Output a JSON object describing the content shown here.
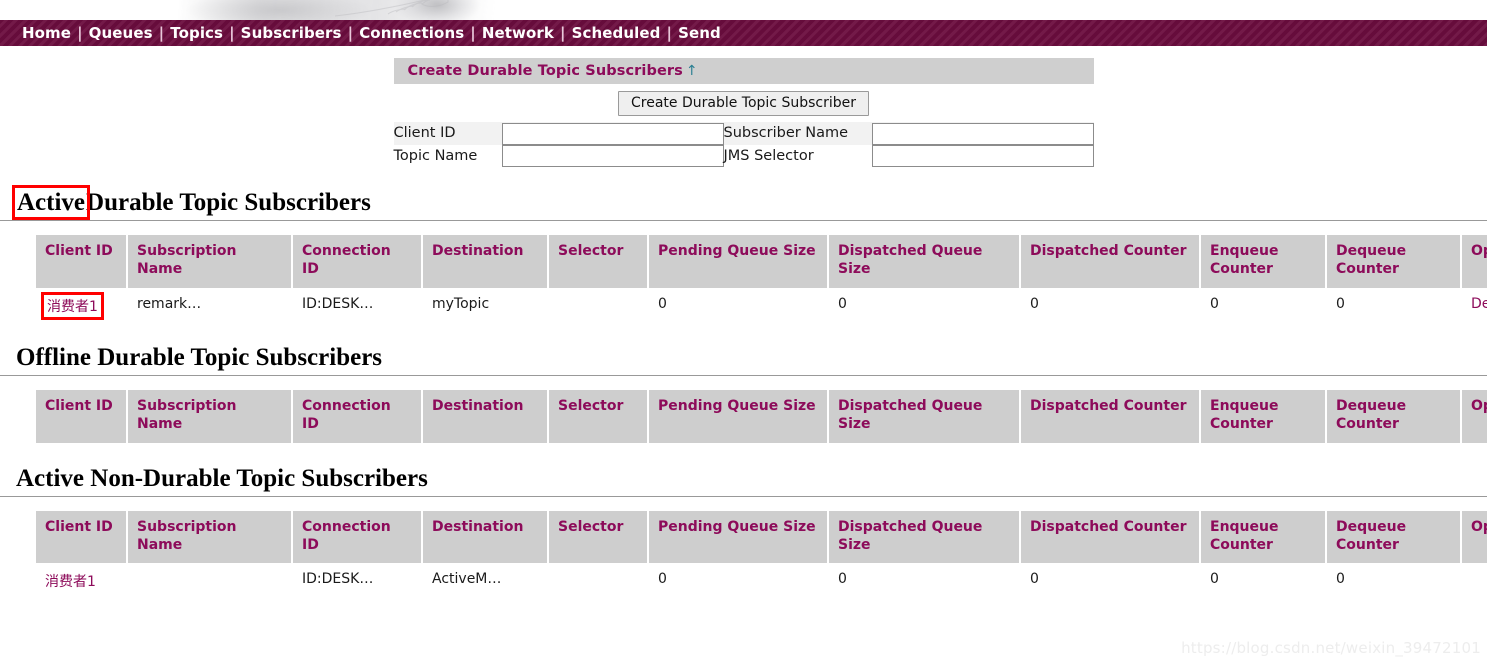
{
  "nav": {
    "items": [
      "Home",
      "Queues",
      "Topics",
      "Subscribers",
      "Connections",
      "Network",
      "Scheduled",
      "Send"
    ],
    "separator": "|"
  },
  "create_panel": {
    "title": "Create Durable Topic Subscribers",
    "title_arrow": "↑",
    "submit_label": "Create Durable Topic Subscriber",
    "fields": [
      {
        "label": "Client ID",
        "value": "",
        "placeholder": ""
      },
      {
        "label": "Subscriber Name",
        "value": "",
        "placeholder": ""
      },
      {
        "label": "Topic Name",
        "value": "",
        "placeholder": ""
      },
      {
        "label": "JMS Selector",
        "value": "",
        "placeholder": ""
      }
    ]
  },
  "columns": [
    "Client ID",
    "Subscription Name",
    "Connection ID",
    "Destination",
    "Selector",
    "Pending Queue Size",
    "Dispatched Queue Size",
    "Dispatched Counter",
    "Enqueue Counter",
    "Dequeue Counter",
    "Operations"
  ],
  "sections": [
    {
      "heading_highlight": "Active",
      "heading_rest": "Durable Topic Subscribers",
      "rows": [
        {
          "client_id": "消费者1",
          "subscription_name": "remark…",
          "connection_id": "ID:DESK…",
          "destination": "myTopic",
          "selector": "",
          "pending_queue_size": "0",
          "dispatched_queue_size": "0",
          "dispatched_counter": "0",
          "enqueue_counter": "0",
          "dequeue_counter": "0",
          "operations": "Delete"
        }
      ]
    },
    {
      "heading_highlight": "",
      "heading_rest": "Offline Durable Topic Subscribers",
      "rows": []
    },
    {
      "heading_highlight": "",
      "heading_rest": "Active Non-Durable Topic Subscribers",
      "rows": [
        {
          "client_id": "消费者1",
          "subscription_name": "",
          "connection_id": "ID:DESK…",
          "destination": "ActiveM…",
          "selector": "",
          "pending_queue_size": "0",
          "dispatched_queue_size": "0",
          "dispatched_counter": "0",
          "enqueue_counter": "0",
          "dequeue_counter": "0",
          "operations": ""
        }
      ]
    }
  ],
  "watermark": "https://blog.csdn.net/weixin_39472101",
  "colors": {
    "nav_bg": "#6b0d3e",
    "accent": "#8d0b5a",
    "header_bg": "#cecece",
    "panel_bg": "#cfcfcf",
    "annotation": "#ff0000",
    "arrow": "#2a7f92"
  }
}
